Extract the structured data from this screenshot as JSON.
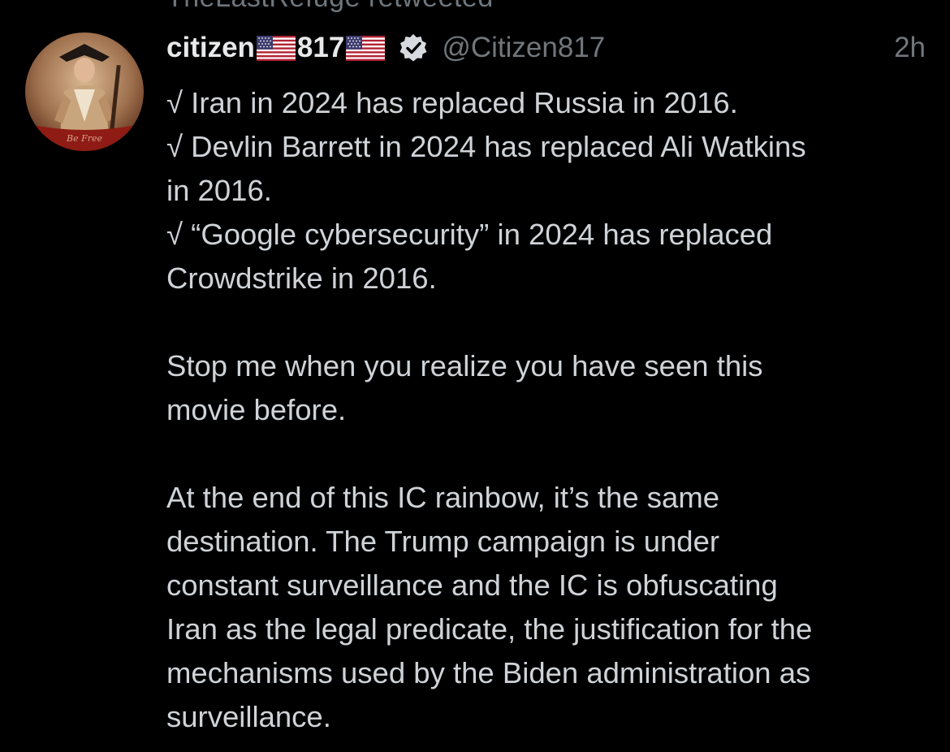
{
  "retweet_context": {
    "text": "TheLastRefuge retweeted"
  },
  "tweet": {
    "author": {
      "name_part1": "citizen",
      "name_part2": "817",
      "handle": "@Citizen817",
      "verified": true,
      "avatar_icon": "revolutionary-soldier-avatar"
    },
    "time": "2h",
    "lines": [
      "√ Iran in 2024 has replaced Russia in 2016.",
      "√ Devlin Barrett in 2024 has replaced Ali Watkins",
      "in 2016.",
      "√ “Google cybersecurity” in 2024 has replaced",
      "Crowdstrike in 2016.",
      "",
      "Stop me when you realize you have seen this",
      "movie before.",
      "",
      "At the end of this IC rainbow, it’s the same",
      "destination.  The Trump campaign is under",
      "constant surveillance and the IC is obfuscating",
      "Iran as the legal predicate, the justification for the",
      "mechanisms used by the Biden administration as",
      "surveillance."
    ]
  },
  "icons": {
    "flag": "us-flag-icon",
    "verified": "verified-badge-icon"
  },
  "colors": {
    "background": "#000000",
    "text": "#cfd3d7",
    "name": "#e7e9ea",
    "muted": "#71767b",
    "verified_badge": "#d7dbdf"
  }
}
